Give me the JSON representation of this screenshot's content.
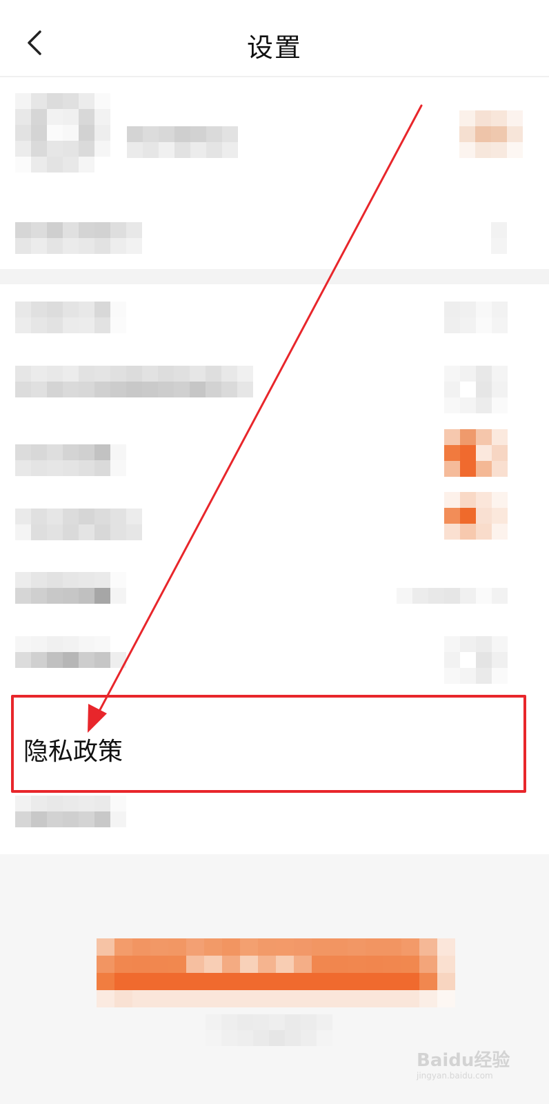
{
  "header": {
    "title": "设置"
  },
  "highlighted_item": {
    "label": "隐私政策"
  },
  "watermark": {
    "brand": "Baidu经验",
    "url": "jingyan.baidu.com"
  },
  "colors": {
    "accent": "#f06a2e",
    "annotation_red": "#e8262b",
    "pixelated_gray": "#c9c9c9"
  },
  "icons": {
    "back": "chevron-left-icon"
  }
}
